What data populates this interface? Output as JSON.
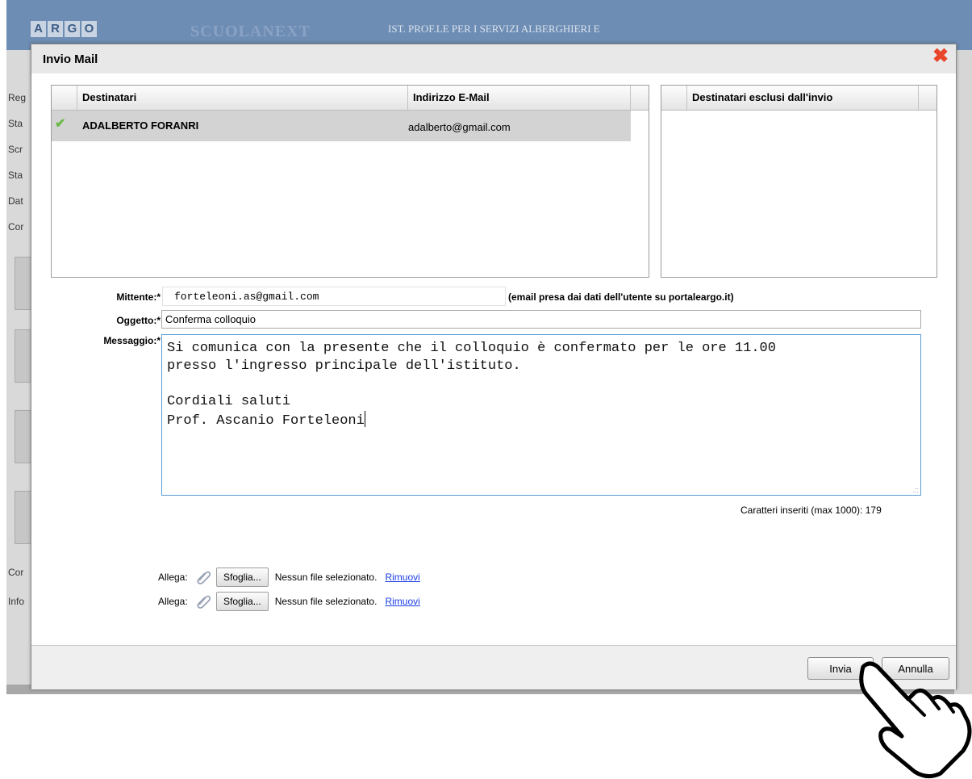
{
  "app": {
    "logo_letters": [
      "A",
      "R",
      "G",
      "O"
    ],
    "product": "SCUOLANEXT",
    "school_name": "IST. PROF.LE PER I SERVIZI ALBERGHIERI E",
    "side_items": [
      "Reg",
      "Sta",
      "Scr",
      "Sta",
      "Dat",
      "Cor",
      "Cor",
      "Info"
    ]
  },
  "dialog": {
    "title": "Invio Mail",
    "close_icon": "close-x-icon",
    "recipients": {
      "columns": [
        "Destinatari",
        "Indirizzo E-Mail"
      ],
      "rows": [
        {
          "name": "ADALBERTO FORANRI",
          "email": "adalberto@gmail.com",
          "status_icon": "check-icon"
        }
      ]
    },
    "excluded": {
      "columns": [
        "Destinatari esclusi dall'invio"
      ]
    },
    "form": {
      "sender_label": "Mittente:*",
      "sender_value": "forteleoni.as@gmail.com",
      "sender_note": "(email presa dai dati dell'utente su portaleargo.it)",
      "subject_label": "Oggetto:*",
      "subject_value": "Conferma colloquio",
      "message_label": "Messaggio:*",
      "message_lines": [
        "Si comunica con la presente che il colloquio è confermato per le ore 11.00",
        "presso l'ingresso principale dell'istituto.",
        "",
        "Cordiali saluti",
        "Prof. Ascanio Forteleoni"
      ],
      "char_counter": "Caratteri inseriti (max 1000): 179"
    },
    "attachments": [
      {
        "label": "Allega:",
        "browse": "Sfoglia...",
        "status": "Nessun file selezionato.",
        "remove": "Rimuovi"
      },
      {
        "label": "Allega:",
        "browse": "Sfoglia...",
        "status": "Nessun file selezionato.",
        "remove": "Rimuovi"
      }
    ],
    "buttons": {
      "send": "Invia",
      "cancel": "Annulla"
    }
  },
  "colors": {
    "header_blue": "#6e8db4",
    "close_red": "#e8452a",
    "check_green": "#66bb44",
    "link_blue": "#1a3de6"
  }
}
